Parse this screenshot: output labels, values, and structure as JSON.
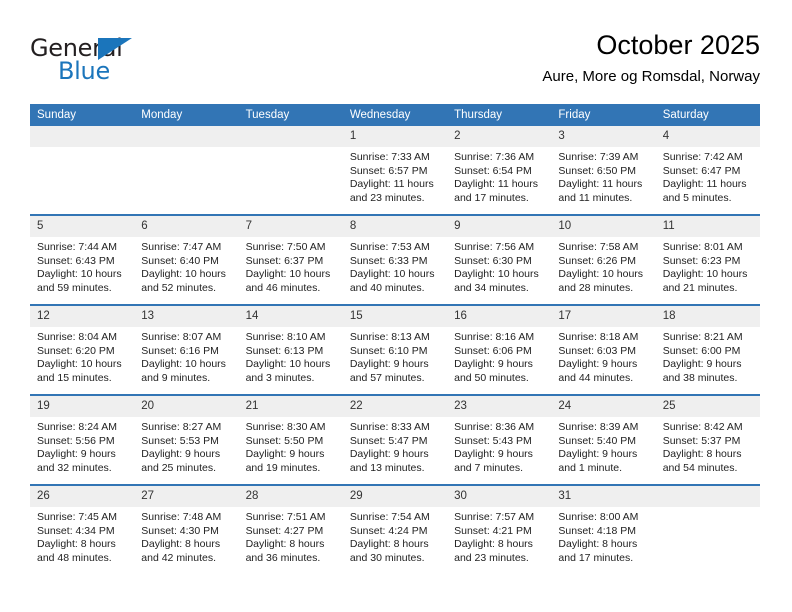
{
  "brand": {
    "name_part1": "General",
    "name_part2": "Blue",
    "colors": {
      "dark": "#231f20",
      "blue": "#1b75bb"
    }
  },
  "header": {
    "title": "October 2025",
    "subtitle": "Aure, More og Romsdal, Norway"
  },
  "theme": {
    "header_blue": "#3275b5",
    "daynum_band": "#efefef",
    "cell_background": "#ffffff"
  },
  "calendar": {
    "weekday_headers": [
      "Sunday",
      "Monday",
      "Tuesday",
      "Wednesday",
      "Thursday",
      "Friday",
      "Saturday"
    ],
    "labels": {
      "sunrise": "Sunrise:",
      "sunset": "Sunset:",
      "daylight": "Daylight:"
    },
    "weeks": [
      [
        {
          "day": "",
          "empty": true,
          "sunrise": "",
          "sunset": "",
          "daylight1": "",
          "daylight2": ""
        },
        {
          "day": "",
          "empty": true,
          "sunrise": "",
          "sunset": "",
          "daylight1": "",
          "daylight2": ""
        },
        {
          "day": "",
          "empty": true,
          "sunrise": "",
          "sunset": "",
          "daylight1": "",
          "daylight2": ""
        },
        {
          "day": "1",
          "empty": false,
          "sunrise": "Sunrise: 7:33 AM",
          "sunset": "Sunset: 6:57 PM",
          "daylight1": "Daylight: 11 hours",
          "daylight2": "and 23 minutes."
        },
        {
          "day": "2",
          "empty": false,
          "sunrise": "Sunrise: 7:36 AM",
          "sunset": "Sunset: 6:54 PM",
          "daylight1": "Daylight: 11 hours",
          "daylight2": "and 17 minutes."
        },
        {
          "day": "3",
          "empty": false,
          "sunrise": "Sunrise: 7:39 AM",
          "sunset": "Sunset: 6:50 PM",
          "daylight1": "Daylight: 11 hours",
          "daylight2": "and 11 minutes."
        },
        {
          "day": "4",
          "empty": false,
          "sunrise": "Sunrise: 7:42 AM",
          "sunset": "Sunset: 6:47 PM",
          "daylight1": "Daylight: 11 hours",
          "daylight2": "and 5 minutes."
        }
      ],
      [
        {
          "day": "5",
          "empty": false,
          "sunrise": "Sunrise: 7:44 AM",
          "sunset": "Sunset: 6:43 PM",
          "daylight1": "Daylight: 10 hours",
          "daylight2": "and 59 minutes."
        },
        {
          "day": "6",
          "empty": false,
          "sunrise": "Sunrise: 7:47 AM",
          "sunset": "Sunset: 6:40 PM",
          "daylight1": "Daylight: 10 hours",
          "daylight2": "and 52 minutes."
        },
        {
          "day": "7",
          "empty": false,
          "sunrise": "Sunrise: 7:50 AM",
          "sunset": "Sunset: 6:37 PM",
          "daylight1": "Daylight: 10 hours",
          "daylight2": "and 46 minutes."
        },
        {
          "day": "8",
          "empty": false,
          "sunrise": "Sunrise: 7:53 AM",
          "sunset": "Sunset: 6:33 PM",
          "daylight1": "Daylight: 10 hours",
          "daylight2": "and 40 minutes."
        },
        {
          "day": "9",
          "empty": false,
          "sunrise": "Sunrise: 7:56 AM",
          "sunset": "Sunset: 6:30 PM",
          "daylight1": "Daylight: 10 hours",
          "daylight2": "and 34 minutes."
        },
        {
          "day": "10",
          "empty": false,
          "sunrise": "Sunrise: 7:58 AM",
          "sunset": "Sunset: 6:26 PM",
          "daylight1": "Daylight: 10 hours",
          "daylight2": "and 28 minutes."
        },
        {
          "day": "11",
          "empty": false,
          "sunrise": "Sunrise: 8:01 AM",
          "sunset": "Sunset: 6:23 PM",
          "daylight1": "Daylight: 10 hours",
          "daylight2": "and 21 minutes."
        }
      ],
      [
        {
          "day": "12",
          "empty": false,
          "sunrise": "Sunrise: 8:04 AM",
          "sunset": "Sunset: 6:20 PM",
          "daylight1": "Daylight: 10 hours",
          "daylight2": "and 15 minutes."
        },
        {
          "day": "13",
          "empty": false,
          "sunrise": "Sunrise: 8:07 AM",
          "sunset": "Sunset: 6:16 PM",
          "daylight1": "Daylight: 10 hours",
          "daylight2": "and 9 minutes."
        },
        {
          "day": "14",
          "empty": false,
          "sunrise": "Sunrise: 8:10 AM",
          "sunset": "Sunset: 6:13 PM",
          "daylight1": "Daylight: 10 hours",
          "daylight2": "and 3 minutes."
        },
        {
          "day": "15",
          "empty": false,
          "sunrise": "Sunrise: 8:13 AM",
          "sunset": "Sunset: 6:10 PM",
          "daylight1": "Daylight: 9 hours",
          "daylight2": "and 57 minutes."
        },
        {
          "day": "16",
          "empty": false,
          "sunrise": "Sunrise: 8:16 AM",
          "sunset": "Sunset: 6:06 PM",
          "daylight1": "Daylight: 9 hours",
          "daylight2": "and 50 minutes."
        },
        {
          "day": "17",
          "empty": false,
          "sunrise": "Sunrise: 8:18 AM",
          "sunset": "Sunset: 6:03 PM",
          "daylight1": "Daylight: 9 hours",
          "daylight2": "and 44 minutes."
        },
        {
          "day": "18",
          "empty": false,
          "sunrise": "Sunrise: 8:21 AM",
          "sunset": "Sunset: 6:00 PM",
          "daylight1": "Daylight: 9 hours",
          "daylight2": "and 38 minutes."
        }
      ],
      [
        {
          "day": "19",
          "empty": false,
          "sunrise": "Sunrise: 8:24 AM",
          "sunset": "Sunset: 5:56 PM",
          "daylight1": "Daylight: 9 hours",
          "daylight2": "and 32 minutes."
        },
        {
          "day": "20",
          "empty": false,
          "sunrise": "Sunrise: 8:27 AM",
          "sunset": "Sunset: 5:53 PM",
          "daylight1": "Daylight: 9 hours",
          "daylight2": "and 25 minutes."
        },
        {
          "day": "21",
          "empty": false,
          "sunrise": "Sunrise: 8:30 AM",
          "sunset": "Sunset: 5:50 PM",
          "daylight1": "Daylight: 9 hours",
          "daylight2": "and 19 minutes."
        },
        {
          "day": "22",
          "empty": false,
          "sunrise": "Sunrise: 8:33 AM",
          "sunset": "Sunset: 5:47 PM",
          "daylight1": "Daylight: 9 hours",
          "daylight2": "and 13 minutes."
        },
        {
          "day": "23",
          "empty": false,
          "sunrise": "Sunrise: 8:36 AM",
          "sunset": "Sunset: 5:43 PM",
          "daylight1": "Daylight: 9 hours",
          "daylight2": "and 7 minutes."
        },
        {
          "day": "24",
          "empty": false,
          "sunrise": "Sunrise: 8:39 AM",
          "sunset": "Sunset: 5:40 PM",
          "daylight1": "Daylight: 9 hours",
          "daylight2": "and 1 minute."
        },
        {
          "day": "25",
          "empty": false,
          "sunrise": "Sunrise: 8:42 AM",
          "sunset": "Sunset: 5:37 PM",
          "daylight1": "Daylight: 8 hours",
          "daylight2": "and 54 minutes."
        }
      ],
      [
        {
          "day": "26",
          "empty": false,
          "sunrise": "Sunrise: 7:45 AM",
          "sunset": "Sunset: 4:34 PM",
          "daylight1": "Daylight: 8 hours",
          "daylight2": "and 48 minutes."
        },
        {
          "day": "27",
          "empty": false,
          "sunrise": "Sunrise: 7:48 AM",
          "sunset": "Sunset: 4:30 PM",
          "daylight1": "Daylight: 8 hours",
          "daylight2": "and 42 minutes."
        },
        {
          "day": "28",
          "empty": false,
          "sunrise": "Sunrise: 7:51 AM",
          "sunset": "Sunset: 4:27 PM",
          "daylight1": "Daylight: 8 hours",
          "daylight2": "and 36 minutes."
        },
        {
          "day": "29",
          "empty": false,
          "sunrise": "Sunrise: 7:54 AM",
          "sunset": "Sunset: 4:24 PM",
          "daylight1": "Daylight: 8 hours",
          "daylight2": "and 30 minutes."
        },
        {
          "day": "30",
          "empty": false,
          "sunrise": "Sunrise: 7:57 AM",
          "sunset": "Sunset: 4:21 PM",
          "daylight1": "Daylight: 8 hours",
          "daylight2": "and 23 minutes."
        },
        {
          "day": "31",
          "empty": false,
          "sunrise": "Sunrise: 8:00 AM",
          "sunset": "Sunset: 4:18 PM",
          "daylight1": "Daylight: 8 hours",
          "daylight2": "and 17 minutes."
        },
        {
          "day": "",
          "empty": true,
          "sunrise": "",
          "sunset": "",
          "daylight1": "",
          "daylight2": ""
        }
      ]
    ]
  }
}
